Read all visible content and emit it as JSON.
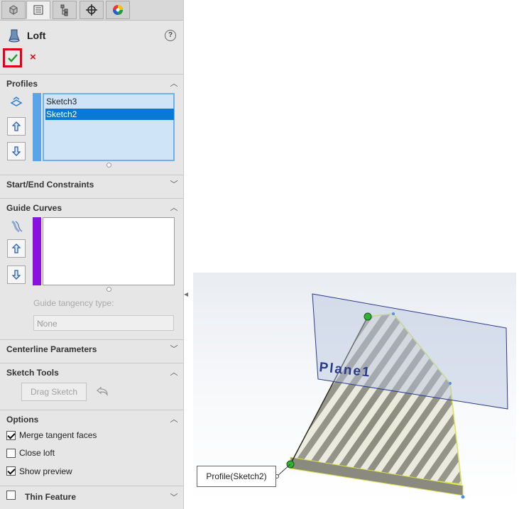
{
  "feature": {
    "title": "Loft",
    "help": "?",
    "ok_icon": "checkmark-icon",
    "cancel_glyph": "×"
  },
  "tabs": [
    "feature-manager-icon",
    "property-manager-icon",
    "configuration-manager-icon",
    "dimxpert-icon",
    "display-manager-icon"
  ],
  "sections": {
    "profiles": {
      "label": "Profiles",
      "items": [
        {
          "label": "Sketch3",
          "selected": false
        },
        {
          "label": "Sketch2",
          "selected": true
        }
      ],
      "color": "#5aa5e8"
    },
    "start_end": {
      "label": "Start/End Constraints"
    },
    "guide_curves": {
      "label": "Guide Curves",
      "color": "#8a12e0",
      "tangency_label": "Guide tangency type:",
      "tangency_value": "None"
    },
    "centerline": {
      "label": "Centerline Parameters"
    },
    "sketch_tools": {
      "label": "Sketch Tools",
      "drag_label": "Drag Sketch"
    },
    "options": {
      "label": "Options",
      "merge": "Merge tangent faces",
      "close": "Close loft",
      "preview": "Show preview"
    },
    "thin": {
      "label": "Thin Feature"
    }
  },
  "graphics": {
    "plane_label": "Plane1",
    "callout": "Profile(Sketch2)"
  }
}
